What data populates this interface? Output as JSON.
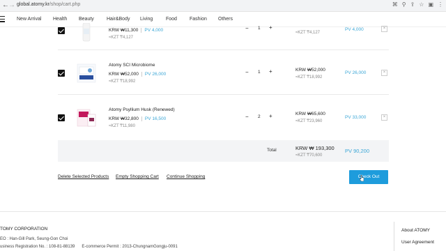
{
  "browser": {
    "back": "←",
    "forward": "→",
    "url_host": "global.atomy.kr",
    "url_path": "/shop/cart.php"
  },
  "nav": {
    "items": [
      "New Arrival",
      "Health",
      "Beauty",
      "Hair&Body",
      "Living",
      "Food",
      "Fashion",
      "Others"
    ]
  },
  "cart": {
    "items": [
      {
        "name": "",
        "price": "KRW ₩11,300",
        "pv": "PV 4,000",
        "kzt": "≈KZT ₸4,127",
        "qty": "1",
        "line_total": "",
        "line_kzt": "≈KZT ₸4,127",
        "line_pv": "PV 4,000"
      },
      {
        "name": "Atomy SCI Microbiome",
        "price": "KRW ₩52,000",
        "pv": "PV 26,000",
        "kzt": "≈KZT ₸18,992",
        "qty": "1",
        "line_total": "KRW ₩52,000",
        "line_kzt": "≈KZT ₸18,992",
        "line_pv": "PV 26,000"
      },
      {
        "name": "Atomy Psyllium Husk (Renewed)",
        "price": "KRW ₩32,800",
        "pv": "PV 16,500",
        "kzt": "≈KZT ₸11,980",
        "qty": "2",
        "line_total": "KRW ₩65,600",
        "line_kzt": "≈KZT ₸23,960",
        "line_pv": "PV 33,000"
      }
    ],
    "remove_label": "×",
    "minus": "−",
    "plus": "+",
    "total_label": "Total",
    "total_krw": "KRW ₩ 193,300",
    "total_kzt": "≈KZT ₸70,600",
    "total_pv": "PV 90,200"
  },
  "actions": {
    "delete_selected": "Delete Selected Products",
    "empty_cart": "Empty Shopping Cart",
    "continue": "Continue Shopping",
    "checkout": "Check Out"
  },
  "footer": {
    "company": "TOMY CORPORATION",
    "ceo": "EO : Han-Gill Park, Seung-Gon Choi",
    "reg": "usiness Registration No. : 108-81-88139",
    "permit": "E-commerce Permit : 2013-ChungnamGongju-0091",
    "links": [
      "About ATOMY",
      "User Agreement"
    ]
  },
  "colors": {
    "accent": "#1e9cdc",
    "pv": "#3aa6d6"
  }
}
